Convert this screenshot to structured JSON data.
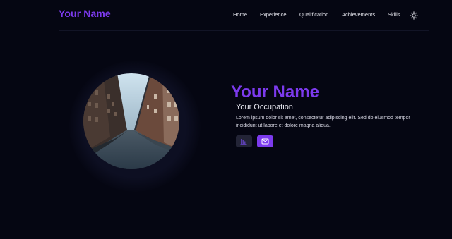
{
  "header": {
    "brand": "Your Name",
    "nav": [
      {
        "label": "Home"
      },
      {
        "label": "Experience"
      },
      {
        "label": "Qualification"
      },
      {
        "label": "Achievements"
      },
      {
        "label": "Skills"
      }
    ],
    "theme_icon": "sun-icon"
  },
  "hero": {
    "name": "Your Name",
    "occupation": "Your Occupation",
    "bio": "Lorem ipsum dolor sit amet, consectetur adipiscing elit. Sed do eiusmod tempor incididunt ut labore et dolore magna aliqua.",
    "buttons": [
      {
        "icon": "bar-chart-icon"
      },
      {
        "icon": "mail-icon"
      }
    ]
  },
  "colors": {
    "background": "#050612",
    "accent": "#7c3aed",
    "secondary_button": "#232436"
  }
}
